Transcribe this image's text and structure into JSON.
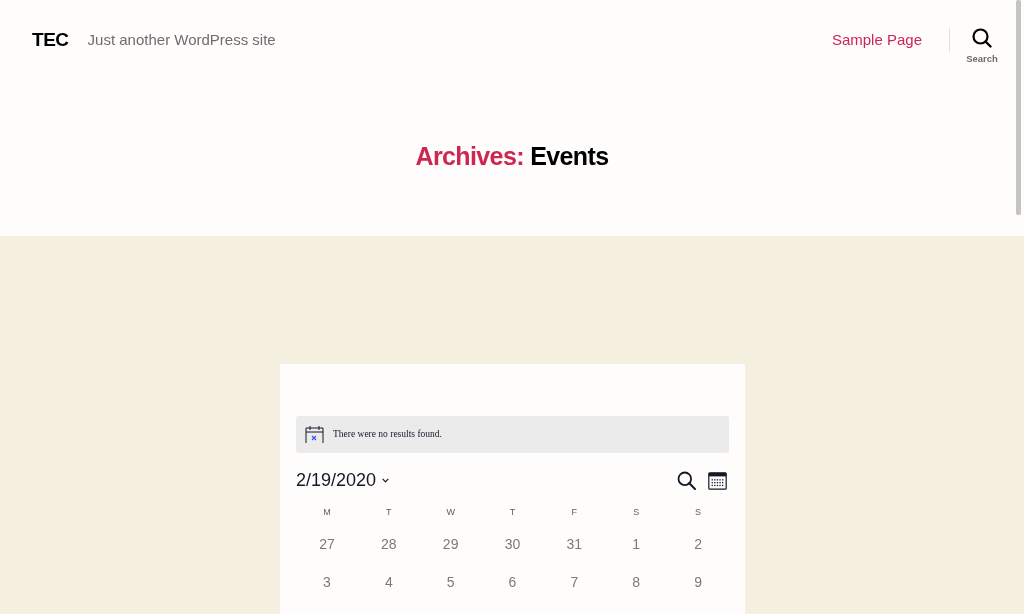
{
  "header": {
    "site_title": "TEC",
    "tagline": "Just another WordPress site",
    "nav": [
      {
        "label": "Sample Page"
      }
    ],
    "search_toggle": {
      "label": "Search"
    }
  },
  "archive_title": {
    "prefix": "Archives:",
    "name": "Events"
  },
  "events_calendar": {
    "notice": "There were no results found.",
    "date_picker": {
      "label": "2/19/2020"
    },
    "weekdays": [
      "M",
      "T",
      "W",
      "T",
      "F",
      "S",
      "S"
    ],
    "weeks": [
      [
        "27",
        "28",
        "29",
        "30",
        "31",
        "1",
        "2"
      ],
      [
        "3",
        "4",
        "5",
        "6",
        "7",
        "8",
        "9"
      ]
    ]
  }
}
